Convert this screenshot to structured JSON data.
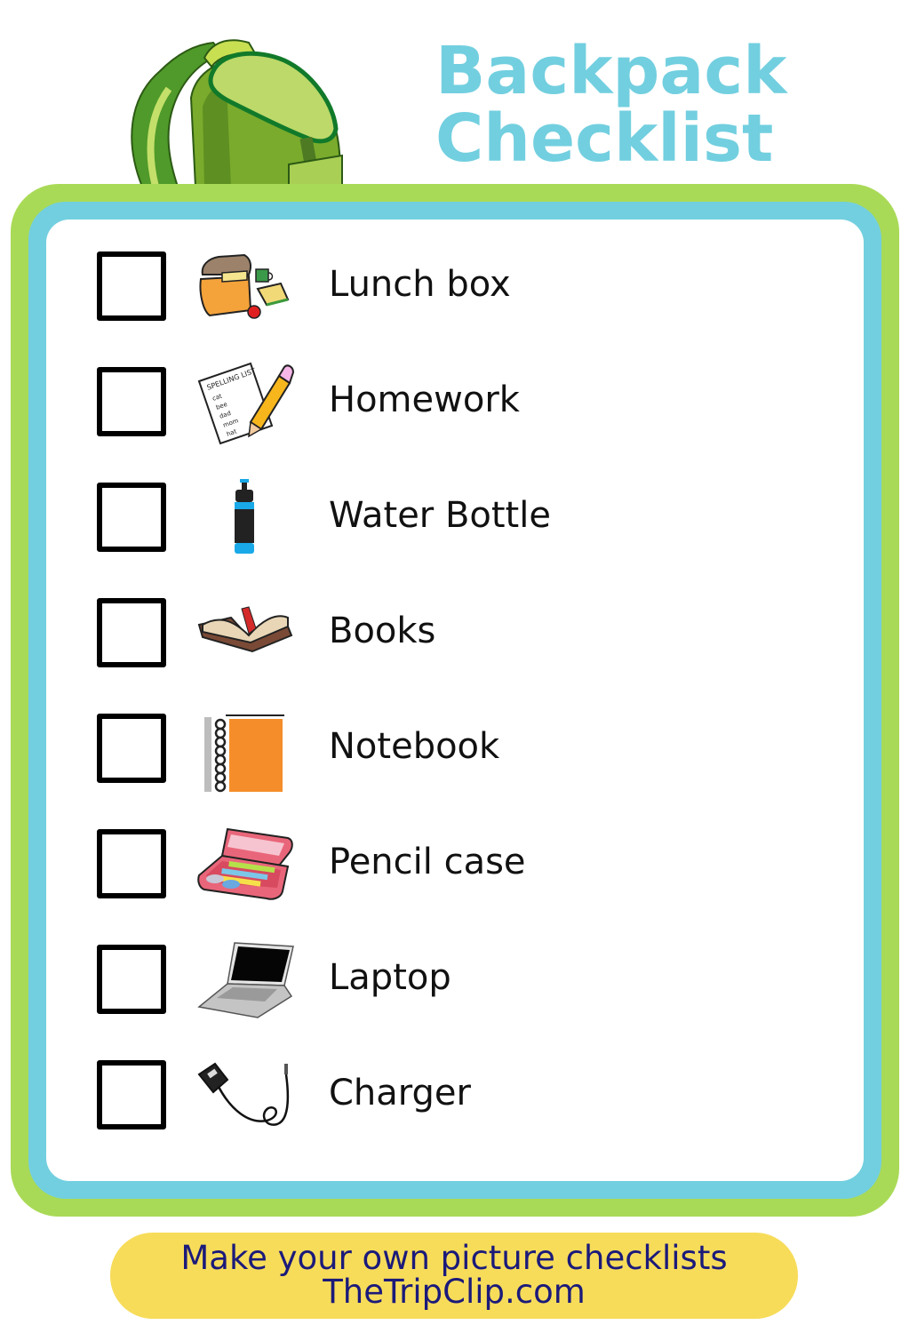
{
  "header": {
    "title_line1": "Backpack",
    "title_line2": "Checklist",
    "illustration": "backpack-icon"
  },
  "colors": {
    "title": "#72cfdf",
    "frame_outer": "#a9da57",
    "frame_inner": "#72cfdf",
    "footer_bg": "#f7dc5a",
    "footer_text": "#1b1a7a"
  },
  "checklist": {
    "items": [
      {
        "label": "Lunch box",
        "icon": "lunch-box-icon",
        "checked": false
      },
      {
        "label": "Homework",
        "icon": "homework-icon",
        "checked": false
      },
      {
        "label": "Water Bottle",
        "icon": "water-bottle-icon",
        "checked": false
      },
      {
        "label": "Books",
        "icon": "books-icon",
        "checked": false
      },
      {
        "label": "Notebook",
        "icon": "notebook-icon",
        "checked": false
      },
      {
        "label": "Pencil case",
        "icon": "pencil-case-icon",
        "checked": false
      },
      {
        "label": "Laptop",
        "icon": "laptop-icon",
        "checked": false
      },
      {
        "label": "Charger",
        "icon": "charger-icon",
        "checked": false
      }
    ],
    "homework_sheet": {
      "heading": "SPELLING LIST",
      "words": [
        "cat",
        "bee",
        "dad",
        "mom",
        "hat"
      ]
    }
  },
  "footer": {
    "line1": "Make your own picture checklists",
    "line2": "TheTripClip.com"
  }
}
